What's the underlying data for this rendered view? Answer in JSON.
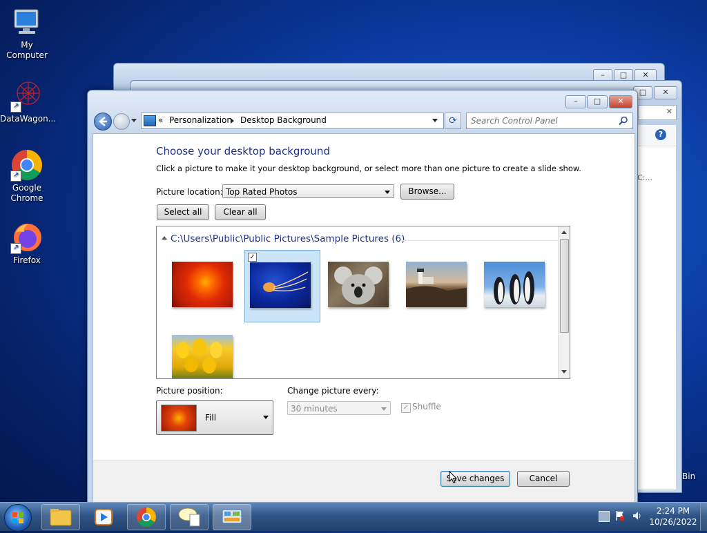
{
  "desktop": {
    "icons": [
      {
        "label": "My Computer"
      },
      {
        "label": "DataWagon..."
      },
      {
        "label": "Google Chrome"
      },
      {
        "label": "Firefox"
      }
    ],
    "partial_labels": {
      "recycle_bin": "Bin",
      "bg_path_text": "C:..."
    }
  },
  "window": {
    "caption_buttons": {
      "minimize": "–",
      "maximize": "□",
      "close": "✕"
    },
    "address": {
      "chevron": "«",
      "crumbs": [
        "Personalization",
        "Desktop Background"
      ],
      "refresh_glyph": "⟳"
    },
    "search": {
      "placeholder": "Search Control Panel"
    },
    "heading": "Choose your desktop background",
    "instruction": "Click a picture to make it your desktop background, or select more than one picture to create a slide show.",
    "picture_location": {
      "label": "Picture location:",
      "value": "Top Rated Photos",
      "browse": "Browse..."
    },
    "select_all": "Select all",
    "clear_all": "Clear all",
    "gallery": {
      "group_title": "C:\\Users\\Public\\Public Pictures\\Sample Pictures (6)",
      "pictures": [
        {
          "name": "chrysanthemum",
          "selected": false
        },
        {
          "name": "jellyfish",
          "selected": true
        },
        {
          "name": "koala",
          "selected": false
        },
        {
          "name": "lighthouse",
          "selected": false
        },
        {
          "name": "penguins",
          "selected": false
        },
        {
          "name": "tulips",
          "selected": false
        }
      ]
    },
    "picture_position": {
      "label": "Picture position:",
      "value": "Fill"
    },
    "change_every": {
      "label": "Change picture every:",
      "value": "30 minutes"
    },
    "shuffle": {
      "label": "Shuffle",
      "checked": true
    },
    "save": "Save changes",
    "cancel": "Cancel"
  },
  "taskbar": {
    "apps": [
      "file-explorer",
      "media-player",
      "google-chrome",
      "paint-notepad",
      "control-panel"
    ],
    "clock": {
      "time": "2:24 PM",
      "date": "10/26/2022"
    }
  },
  "colors": {
    "heading": "#1e3287",
    "accent": "#3c6ea8",
    "selection": "#cce4f7"
  }
}
